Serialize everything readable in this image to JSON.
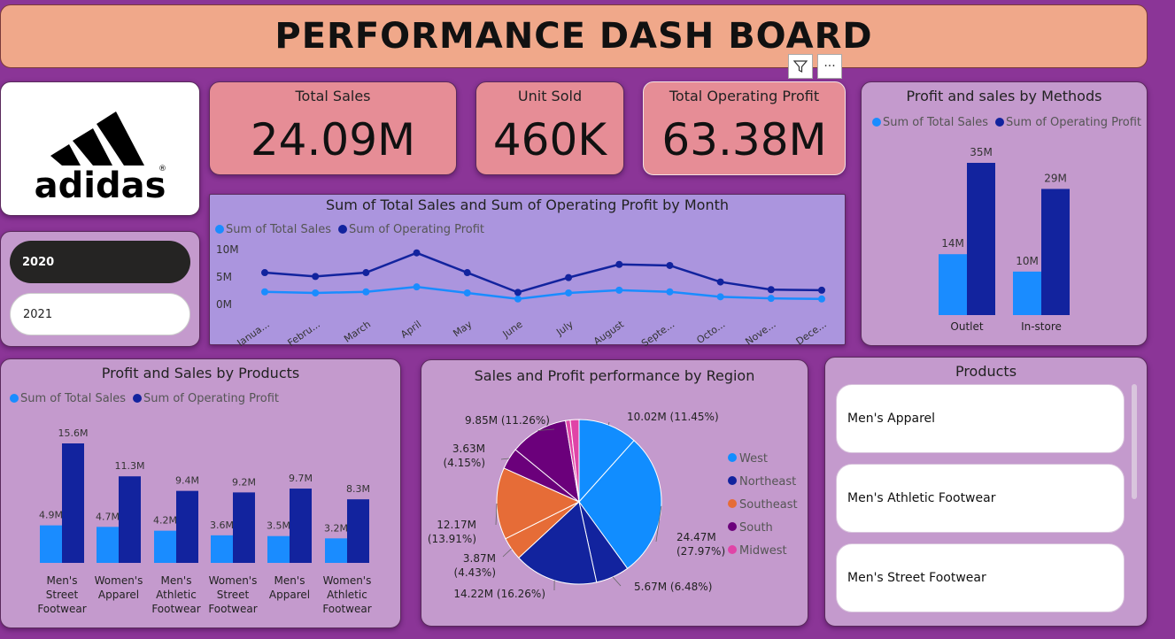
{
  "header": {
    "title": "PERFORMANCE DASH BOARD"
  },
  "logo": {
    "text": "adidas",
    "registered": "®"
  },
  "kpis": [
    {
      "label": "Total Sales",
      "value": "24.09M"
    },
    {
      "label": "Unit Sold",
      "value": "460K"
    },
    {
      "label": "Total Operating Profit",
      "value": "63.38M"
    }
  ],
  "visual_header": {
    "filter_icon": "filter-icon",
    "more_icon": "more-options-icon",
    "more_glyph": "···"
  },
  "year_slicer": {
    "items": [
      "2020",
      "2021"
    ],
    "selected": "2020"
  },
  "legend": {
    "sales": "Sum of Total Sales",
    "profit": "Sum of Operating Profit"
  },
  "colors": {
    "sales": "#1A8CFF",
    "profit": "#12239E",
    "west": "#118DFF",
    "northeast": "#12239E",
    "southeast": "#E66C37",
    "south": "#6B007B",
    "midwest": "#E044A7"
  },
  "products_slicer": {
    "title": "Products",
    "items": [
      "Men's Apparel",
      "Men's Athletic Footwear",
      "Men's Street Footwear"
    ]
  },
  "chart_data": [
    {
      "id": "monthly",
      "type": "line",
      "title": "Sum of Total Sales and Sum of Operating Profit by Month",
      "categories": [
        "Janua...",
        "Febru...",
        "March",
        "April",
        "May",
        "June",
        "July",
        "August",
        "Septe...",
        "Octo...",
        "Nove...",
        "Dece..."
      ],
      "y_ticks": [
        "10M",
        "5M",
        "0M"
      ],
      "ylim": [
        0,
        10
      ],
      "series": [
        {
          "name": "Sum of Total Sales",
          "values": [
            2.3,
            2.1,
            2.3,
            3.2,
            2.1,
            1.0,
            2.1,
            2.6,
            2.3,
            1.4,
            1.1,
            1.0
          ]
        },
        {
          "name": "Sum of Operating Profit",
          "values": [
            5.8,
            5.1,
            5.8,
            9.4,
            5.8,
            2.2,
            4.9,
            7.3,
            7.1,
            4.1,
            2.7,
            2.6
          ]
        }
      ]
    },
    {
      "id": "methods",
      "type": "bar",
      "title": "Profit and sales by Methods",
      "categories": [
        "Outlet",
        "In-store"
      ],
      "series": [
        {
          "name": "Sum of Total Sales",
          "values": [
            14,
            10
          ],
          "labels": [
            "14M",
            "10M"
          ]
        },
        {
          "name": "Sum of Operating Profit",
          "values": [
            35,
            29
          ],
          "labels": [
            "35M",
            "29M"
          ]
        }
      ],
      "ylim": [
        0,
        35
      ]
    },
    {
      "id": "products",
      "type": "bar",
      "title": "Profit and Sales by Products",
      "categories": [
        [
          "Men's",
          "Street",
          "Footwear"
        ],
        [
          "Women's",
          "Apparel"
        ],
        [
          "Men's",
          "Athletic",
          "Footwear"
        ],
        [
          "Women's",
          "Street",
          "Footwear"
        ],
        [
          "Men's",
          "Apparel"
        ],
        [
          "Women's",
          "Athletic",
          "Footwear"
        ]
      ],
      "series": [
        {
          "name": "Sum of Total Sales",
          "values": [
            4.9,
            4.7,
            4.2,
            3.6,
            3.5,
            3.2
          ],
          "labels": [
            "4.9M",
            "4.7M",
            "4.2M",
            "3.6M",
            "3.5M",
            "3.2M"
          ]
        },
        {
          "name": "Sum of Operating Profit",
          "values": [
            15.6,
            11.3,
            9.4,
            9.2,
            9.7,
            8.3
          ],
          "labels": [
            "15.6M",
            "11.3M",
            "9.4M",
            "9.2M",
            "9.7M",
            "8.3M"
          ]
        }
      ],
      "ylim": [
        0,
        15.6
      ]
    },
    {
      "id": "region",
      "type": "pie",
      "title": "Sales and Profit performance by Region",
      "legend": [
        "West",
        "Northeast",
        "Southeast",
        "South",
        "Midwest"
      ],
      "slices": [
        {
          "region": "West",
          "value": 10.02,
          "pct": 11.45,
          "label": [
            "10.02M (11.45%)"
          ]
        },
        {
          "region": "West",
          "value": 24.47,
          "pct": 27.97,
          "label": [
            "24.47M",
            "(27.97%)"
          ]
        },
        {
          "region": "Northeast",
          "value": 5.67,
          "pct": 6.48,
          "label": [
            "5.67M (6.48%)"
          ]
        },
        {
          "region": "Northeast",
          "value": 14.22,
          "pct": 16.26,
          "label": [
            "14.22M (16.26%)"
          ]
        },
        {
          "region": "Southeast",
          "value": 3.87,
          "pct": 4.43,
          "label": [
            "3.87M",
            "(4.43%)"
          ]
        },
        {
          "region": "Southeast",
          "value": 12.17,
          "pct": 13.91,
          "label": [
            "12.17M",
            "(13.91%)"
          ]
        },
        {
          "region": "South",
          "value": 3.63,
          "pct": 4.15,
          "label": [
            "3.63M",
            "(4.15%)"
          ]
        },
        {
          "region": "South",
          "value": 9.85,
          "pct": 11.26,
          "label": [
            "9.85M (11.26%)"
          ]
        },
        {
          "region": "Midwest",
          "value": 0.8,
          "pct": 0.9,
          "label": []
        },
        {
          "region": "Midwest",
          "value": 1.5,
          "pct": 1.7,
          "label": []
        }
      ]
    }
  ]
}
